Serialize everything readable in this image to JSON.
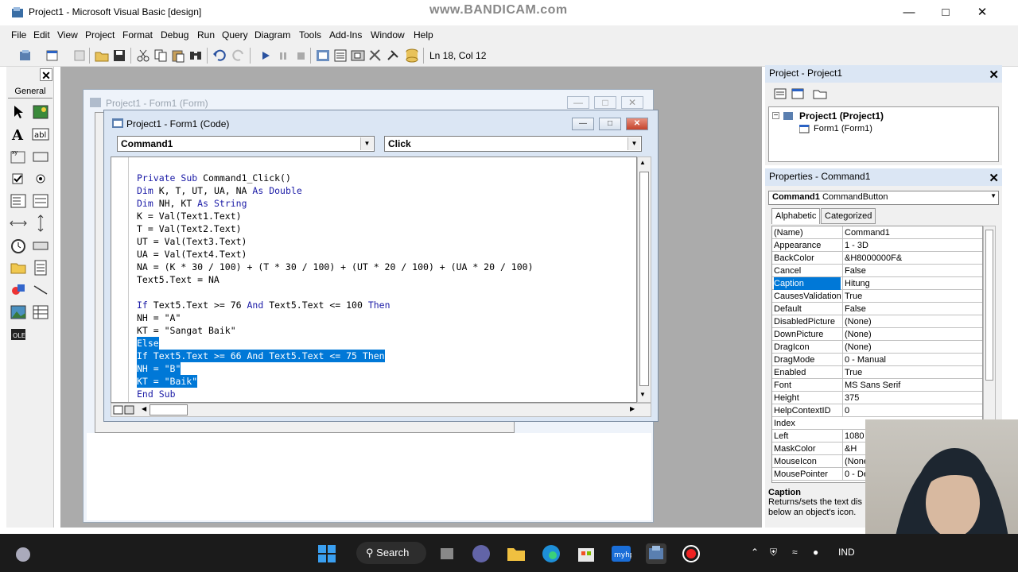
{
  "window": {
    "title": "Project1 - Microsoft Visual Basic [design]",
    "watermark": "www.BANDICAM.com"
  },
  "menu": [
    "File",
    "Edit",
    "View",
    "Project",
    "Format",
    "Debug",
    "Run",
    "Query",
    "Diagram",
    "Tools",
    "Add-Ins",
    "Window",
    "Help"
  ],
  "toolbar": {
    "status": "Ln 18, Col 12"
  },
  "toolbox": {
    "tab": "General"
  },
  "form_window": {
    "title": "Project1 - Form1 (Form)"
  },
  "code_window": {
    "title": "Project1 - Form1 (Code)",
    "object_combo": "Command1",
    "proc_combo": "Click",
    "lines": [
      {
        "code": "Private Sub Command1_Click()",
        "sel": false
      },
      {
        "code": "Dim K, T, UT, UA, NA As Double",
        "sel": false
      },
      {
        "code": "Dim NH, KT As String",
        "sel": false
      },
      {
        "code": "K = Val(Text1.Text)",
        "sel": false
      },
      {
        "code": "T = Val(Text2.Text)",
        "sel": false
      },
      {
        "code": "UT = Val(Text3.Text)",
        "sel": false
      },
      {
        "code": "UA = Val(Text4.Text)",
        "sel": false
      },
      {
        "code": "NA = (K * 30 / 100) + (T * 30 / 100) + (UT * 20 / 100) + (UA * 20 / 100)",
        "sel": false
      },
      {
        "code": "Text5.Text = NA",
        "sel": false
      },
      {
        "code": "",
        "sel": false
      },
      {
        "code": "If Text5.Text >= 76 And Text5.Text <= 100 Then",
        "sel": false
      },
      {
        "code": "NH = \"A\"",
        "sel": false
      },
      {
        "code": "KT = \"Sangat Baik\"",
        "sel": false
      },
      {
        "code": "Else",
        "sel": true
      },
      {
        "code": "If Text5.Text >= 66 And Text5.Text <= 75 Then",
        "sel": true
      },
      {
        "code": "NH = \"B\"",
        "sel": true
      },
      {
        "code": "KT = \"Baik\"",
        "sel": true
      },
      {
        "code": "End Sub",
        "sel": false
      }
    ]
  },
  "project_panel": {
    "title": "Project - Project1",
    "root": "Project1 (Project1)",
    "child": "Form1 (Form1)"
  },
  "properties_panel": {
    "title": "Properties - Command1",
    "object_name": "Command1",
    "object_type": "CommandButton",
    "tabs": [
      "Alphabetic",
      "Categorized"
    ],
    "rows": [
      {
        "name": "(Name)",
        "value": "Command1"
      },
      {
        "name": "Appearance",
        "value": "1 - 3D"
      },
      {
        "name": "BackColor",
        "value": "&H8000000F&"
      },
      {
        "name": "Cancel",
        "value": "False"
      },
      {
        "name": "Caption",
        "value": "Hitung"
      },
      {
        "name": "CausesValidation",
        "value": "True"
      },
      {
        "name": "Default",
        "value": "False"
      },
      {
        "name": "DisabledPicture",
        "value": "(None)"
      },
      {
        "name": "DownPicture",
        "value": "(None)"
      },
      {
        "name": "DragIcon",
        "value": "(None)"
      },
      {
        "name": "DragMode",
        "value": "0 - Manual"
      },
      {
        "name": "Enabled",
        "value": "True"
      },
      {
        "name": "Font",
        "value": "MS Sans Serif"
      },
      {
        "name": "Height",
        "value": "375"
      },
      {
        "name": "HelpContextID",
        "value": "0"
      },
      {
        "name": "Index",
        "value": ""
      },
      {
        "name": "Left",
        "value": "1080"
      },
      {
        "name": "MaskColor",
        "value": "&H"
      },
      {
        "name": "MouseIcon",
        "value": "(None"
      },
      {
        "name": "MousePointer",
        "value": "0 - De"
      }
    ],
    "desc_title": "Caption",
    "desc_text": "Returns/sets the text dis below an object's icon."
  },
  "taskbar": {
    "search": "Search",
    "lang": "IND"
  }
}
